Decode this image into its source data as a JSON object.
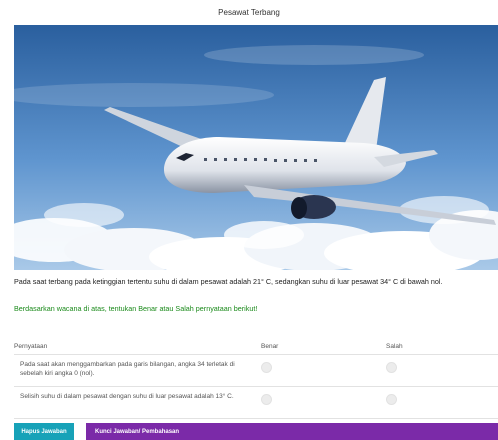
{
  "page": {
    "title": "Pesawat Terbang"
  },
  "image": {
    "subject": "airplane-in-sky"
  },
  "passage": {
    "text": "Pada saat terbang pada ketinggian tertentu suhu di dalam pesawat adalah 21° C, sedangkan suhu di luar pesawat 34° C di bawah nol."
  },
  "instruction": {
    "text": "Berdasarkan wacana di atas, tentukan Benar atau Salah pernyataan berikut!"
  },
  "table": {
    "headers": {
      "statement": "Pernyataan",
      "true": "Benar",
      "false": "Salah"
    },
    "rows": [
      {
        "statement": "Pada saat akan menggambarkan pada garis bilangan, angka 34 terletak di sebelah kiri angka 0 (nol)."
      },
      {
        "statement": "Selisih suhu di dalam pesawat dengan suhu di luar pesawat adalah 13° C."
      }
    ]
  },
  "buttons": {
    "reset": "Hapus Jawaban",
    "answer_key": "Kunci Jawaban/ Pembahasan"
  },
  "colors": {
    "instruction": "#1a8a1a",
    "reset_button": "#17a2b8",
    "answer_button": "#7b2aa8"
  }
}
